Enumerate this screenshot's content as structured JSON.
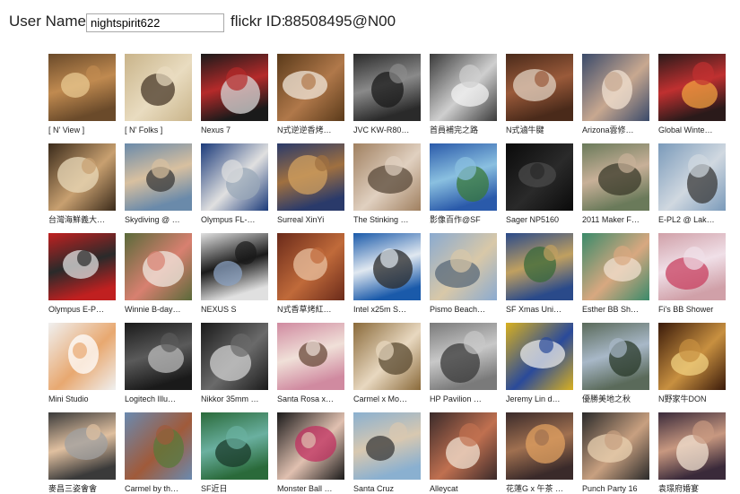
{
  "header": {
    "user_label": "User Name:",
    "user_value": "nightspirit622",
    "flickr_label": "flickr ID:",
    "flickr_value": "88508495@N00"
  },
  "photos": [
    {
      "caption": "[ N' View ]",
      "colors": [
        "#6a4a2a",
        "#c08a50",
        "#e8c890"
      ]
    },
    {
      "caption": "[ N' Folks ]",
      "colors": [
        "#c9b48a",
        "#e9dcc0",
        "#4a3a2a"
      ]
    },
    {
      "caption": "Nexus 7",
      "colors": [
        "#1a1a1a",
        "#b52a2a",
        "#d8d8d8"
      ]
    },
    {
      "caption": "N式逆逆香烤…",
      "colors": [
        "#5a3a1a",
        "#b0784a",
        "#f0e6d8"
      ]
    },
    {
      "caption": "JVC KW-R80…",
      "colors": [
        "#2a2a2a",
        "#8a8a8a",
        "#1a1a1a"
      ]
    },
    {
      "caption": "首員補完之路",
      "colors": [
        "#3a3a3a",
        "#cfcfcf",
        "#f2f2f2"
      ]
    },
    {
      "caption": "N式滷牛腱",
      "colors": [
        "#4a2a1a",
        "#9a5a3a",
        "#e0d0c0"
      ]
    },
    {
      "caption": "Arizona雲修…",
      "colors": [
        "#3a4a6a",
        "#c8a890",
        "#f0e0d0"
      ]
    },
    {
      "caption": "Global Winte…",
      "colors": [
        "#2a1a1a",
        "#c03030",
        "#f0a040"
      ]
    },
    {
      "caption": "台灣海鮮義大…",
      "colors": [
        "#3a2a1a",
        "#c8a070",
        "#e8d8b8"
      ]
    },
    {
      "caption": "Skydiving @ …",
      "colors": [
        "#6a8aaa",
        "#d8c0a0",
        "#3a3a3a"
      ]
    },
    {
      "caption": "Olympus FL-…",
      "colors": [
        "#1a3a7a",
        "#e0e0e0",
        "#9aa8b8"
      ]
    },
    {
      "caption": "Surreal XinYi",
      "colors": [
        "#2a3a6a",
        "#a07040",
        "#d0a060"
      ]
    },
    {
      "caption": "The Stinking …",
      "colors": [
        "#a08060",
        "#e0d0c0",
        "#5a4a3a"
      ]
    },
    {
      "caption": "影像百作@SF",
      "colors": [
        "#2a5aaa",
        "#8ac0e0",
        "#3a7a3a"
      ]
    },
    {
      "caption": "Sager NP5160",
      "colors": [
        "#0a0a0a",
        "#2a2a2a",
        "#4a4a4a"
      ]
    },
    {
      "caption": "2011 Maker F…",
      "colors": [
        "#6a7a5a",
        "#c8b098",
        "#3a3a2a"
      ]
    },
    {
      "caption": "E-PL2 @ Lak…",
      "colors": [
        "#7a9aba",
        "#d0d8e0",
        "#3a3a3a"
      ]
    },
    {
      "caption": "Olympus E-P…",
      "colors": [
        "#c02020",
        "#2a2a2a",
        "#e0e0e0"
      ]
    },
    {
      "caption": "Winnie B-day…",
      "colors": [
        "#5a6a3a",
        "#d88070",
        "#f0e8e0"
      ]
    },
    {
      "caption": "NEXUS S",
      "colors": [
        "#e0e0e0",
        "#1a1a1a",
        "#8aa0c0"
      ]
    },
    {
      "caption": "N式香草烤紅…",
      "colors": [
        "#6a2a1a",
        "#c06a3a",
        "#e8c0a0"
      ]
    },
    {
      "caption": "Intel x25m S…",
      "colors": [
        "#1a5aaa",
        "#e0e8f0",
        "#2a2a2a"
      ]
    },
    {
      "caption": "Pismo Beach…",
      "colors": [
        "#8aaad0",
        "#d8c8a8",
        "#5a6a7a"
      ]
    },
    {
      "caption": "SF Xmas Uni…",
      "colors": [
        "#2a4a8a",
        "#c0a060",
        "#3a6a3a"
      ]
    },
    {
      "caption": "Esther BB Sh…",
      "colors": [
        "#3a8a6a",
        "#d8a880",
        "#f0e0d0"
      ]
    },
    {
      "caption": "Fi's BB Shower",
      "colors": [
        "#d0a0a8",
        "#f0e0e8",
        "#c84060"
      ]
    },
    {
      "caption": "Mini Studio",
      "colors": [
        "#f0f0f0",
        "#e8a870",
        "#ffffff"
      ]
    },
    {
      "caption": "Logitech Illu…",
      "colors": [
        "#1a1a1a",
        "#5a5a5a",
        "#bababa"
      ]
    },
    {
      "caption": "Nikkor 35mm …",
      "colors": [
        "#1a1a1a",
        "#6a6a6a",
        "#d0d0d0"
      ]
    },
    {
      "caption": "Santa Rosa x…",
      "colors": [
        "#d08aa0",
        "#f0e0d8",
        "#6a4a3a"
      ]
    },
    {
      "caption": "Carmel x Mo…",
      "colors": [
        "#8a6a3a",
        "#e8d8c0",
        "#5a4a30"
      ]
    },
    {
      "caption": "HP Pavilion …",
      "colors": [
        "#7a7a7a",
        "#c8c8c8",
        "#3a3a3a"
      ]
    },
    {
      "caption": "Jeremy Lin d…",
      "colors": [
        "#d8b020",
        "#2a4a9a",
        "#e8e8e8"
      ]
    },
    {
      "caption": "優勝美地之秋",
      "colors": [
        "#5a6a5a",
        "#a8b8c8",
        "#2a3a2a"
      ]
    },
    {
      "caption": "N野家牛DON",
      "colors": [
        "#3a1a0a",
        "#c89040",
        "#f0d080"
      ]
    },
    {
      "caption": "麥昌三姿會會",
      "colors": [
        "#3a3a3a",
        "#e0c0a0",
        "#a0a0a0"
      ]
    },
    {
      "caption": "Carmel by th…",
      "colors": [
        "#6a8ab0",
        "#a05a3a",
        "#5a7a3a"
      ]
    },
    {
      "caption": "SF近日",
      "colors": [
        "#2a6a3a",
        "#6ab0a0",
        "#1a3a2a"
      ]
    },
    {
      "caption": "Monster Ball …",
      "colors": [
        "#1a1a1a",
        "#e0c0b0",
        "#c03060"
      ]
    },
    {
      "caption": "Santa Cruz",
      "colors": [
        "#8ab0d0",
        "#d8c8b0",
        "#3a3a3a"
      ]
    },
    {
      "caption": "Alleycat",
      "colors": [
        "#3a2a2a",
        "#c07050",
        "#f0e0d0"
      ]
    },
    {
      "caption": "花蓮G x 午茶 …",
      "colors": [
        "#3a2a2a",
        "#a07050",
        "#e0a060"
      ]
    },
    {
      "caption": "Punch Party 16",
      "colors": [
        "#2a2a2a",
        "#c8a080",
        "#e8d0b0"
      ]
    },
    {
      "caption": "袁璟府婚宴",
      "colors": [
        "#3a2a3a",
        "#c89880",
        "#f0e0d0"
      ]
    }
  ]
}
